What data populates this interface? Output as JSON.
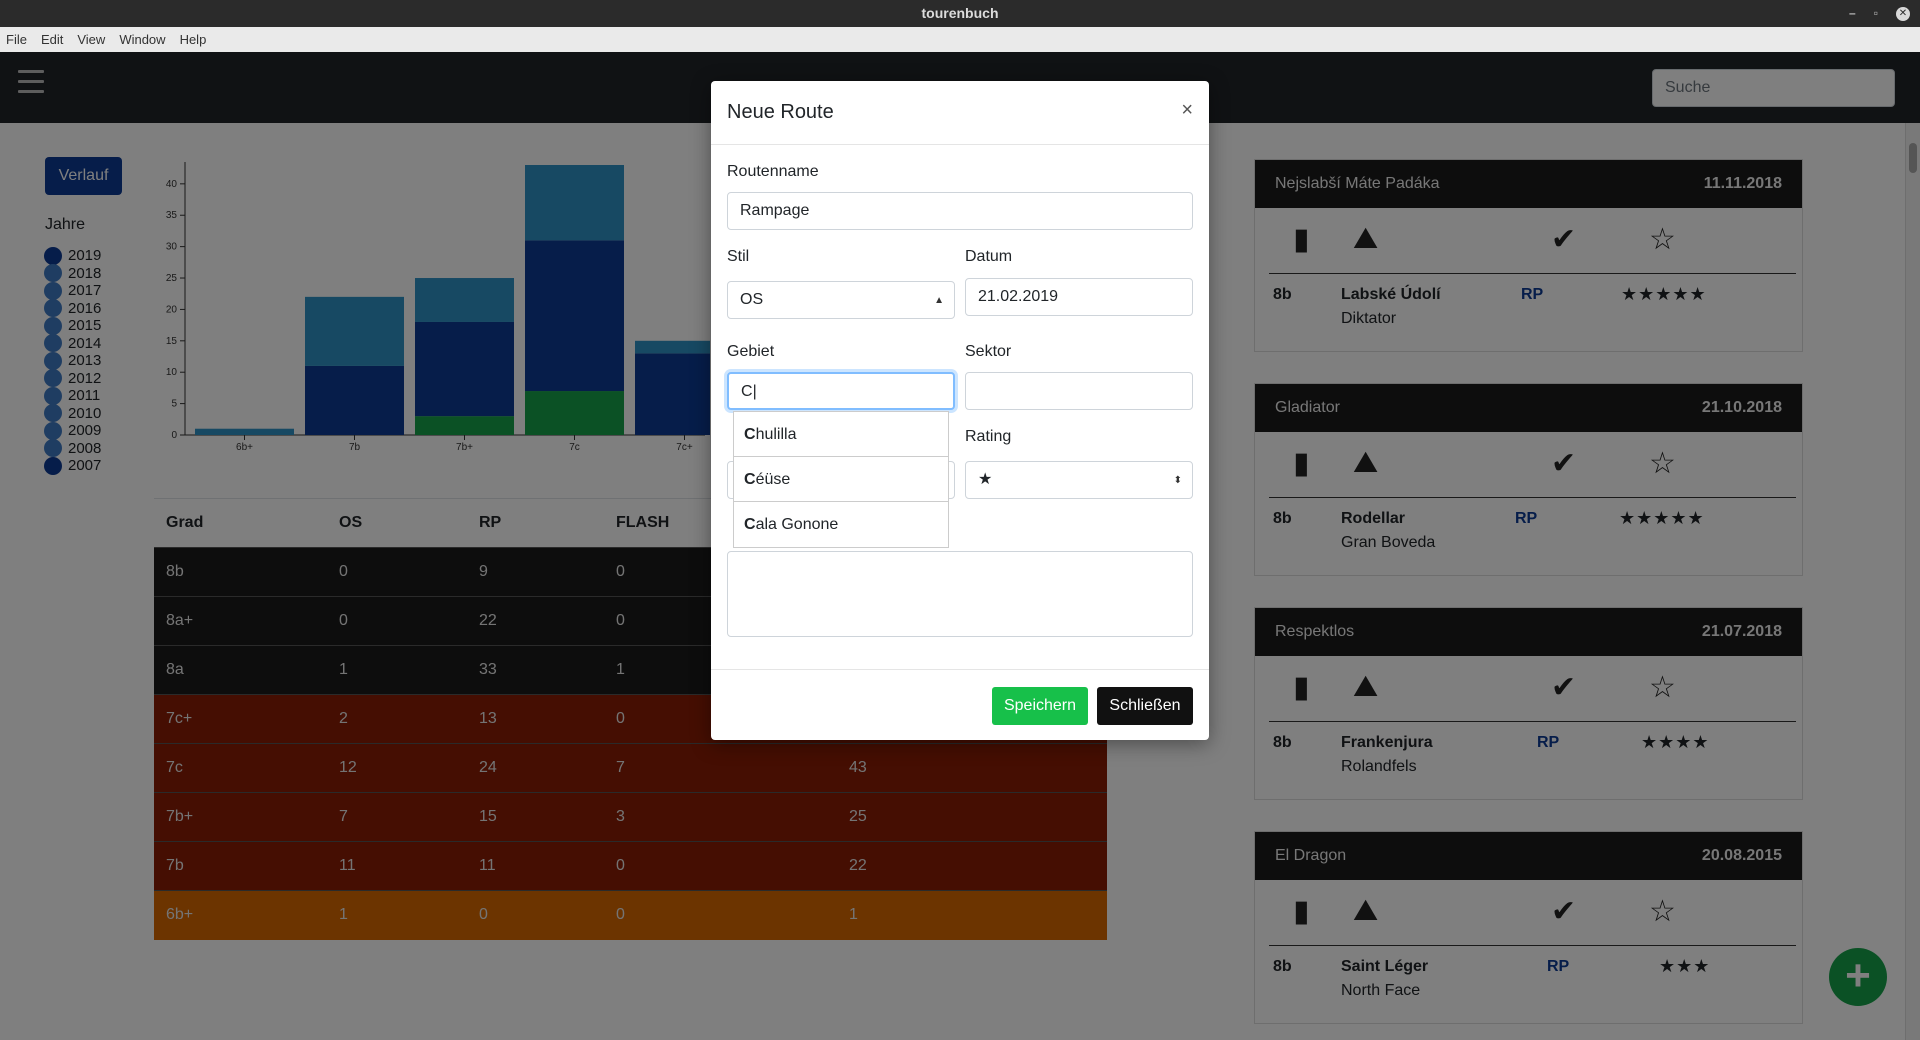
{
  "window": {
    "title": "tourenbuch",
    "controls": [
      "–",
      "▫",
      "✕"
    ]
  },
  "menu": [
    "File",
    "Edit",
    "View",
    "Window",
    "Help"
  ],
  "navbar": {
    "search_placeholder": "Suche"
  },
  "sidebar": {
    "verlauf_label": "Verlauf",
    "jahre_title": "Jahre",
    "years": [
      "2019",
      "2018",
      "2017",
      "2016",
      "2015",
      "2014",
      "2013",
      "2012",
      "2011",
      "2010",
      "2009",
      "2008",
      "2007"
    ]
  },
  "chart_data": {
    "type": "bar",
    "stacked": true,
    "categories": [
      "6b+",
      "7b",
      "7b+",
      "7c",
      "7c+"
    ],
    "series": [
      {
        "color": "#17a34a",
        "values": [
          0,
          0,
          3,
          7,
          0
        ]
      },
      {
        "color": "#0d3b94",
        "values": [
          0,
          11,
          15,
          24,
          13
        ]
      },
      {
        "color": "#2e93c6",
        "values": [
          1,
          11,
          7,
          12,
          2
        ]
      }
    ],
    "ylim": [
      0,
      43
    ],
    "yticks": [
      0,
      5,
      10,
      15,
      20,
      25,
      30,
      35,
      40
    ]
  },
  "grade_table": {
    "headers": [
      "Grad",
      "OS",
      "RP",
      "FLASH",
      ""
    ],
    "rows": [
      {
        "grad": "8b",
        "os": "0",
        "rp": "9",
        "flash": "0",
        "total": "",
        "color": "dark"
      },
      {
        "grad": "8a+",
        "os": "0",
        "rp": "22",
        "flash": "0",
        "total": "",
        "color": "dark"
      },
      {
        "grad": "8a",
        "os": "1",
        "rp": "33",
        "flash": "1",
        "total": "",
        "color": "dark"
      },
      {
        "grad": "7c+",
        "os": "2",
        "rp": "13",
        "flash": "0",
        "total": "",
        "color": "red"
      },
      {
        "grad": "7c",
        "os": "12",
        "rp": "24",
        "flash": "7",
        "total": "43",
        "color": "red"
      },
      {
        "grad": "7b+",
        "os": "7",
        "rp": "15",
        "flash": "3",
        "total": "25",
        "color": "red"
      },
      {
        "grad": "7b",
        "os": "11",
        "rp": "11",
        "flash": "0",
        "total": "22",
        "color": "red"
      },
      {
        "grad": "6b+",
        "os": "1",
        "rp": "0",
        "flash": "0",
        "total": "1",
        "color": "orange"
      }
    ]
  },
  "cards": [
    {
      "name": "Nejslabší Máte Padáka",
      "date": "11.11.2018",
      "grade": "8b",
      "area": "Labské Údolí",
      "sector": "Diktator",
      "style": "RP",
      "stars": "★★★★★"
    },
    {
      "name": "Gladiator",
      "date": "21.10.2018",
      "grade": "8b",
      "area": "Rodellar",
      "sector": "Gran Boveda",
      "style": "RP",
      "stars": "★★★★★"
    },
    {
      "name": "Respektlos",
      "date": "21.07.2018",
      "grade": "8b",
      "area": "Frankenjura",
      "sector": "Rolandfels",
      "style": "RP",
      "stars": "★★★★"
    },
    {
      "name": "El Dragon",
      "date": "20.08.2015",
      "grade": "8b",
      "area": "Saint Léger",
      "sector": "North Face",
      "style": "RP",
      "stars": "★★★"
    }
  ],
  "card_icon_glyphs": {
    "grade": "▮",
    "map": "⛰",
    "check": "✔",
    "star": "☆"
  },
  "fab_label": "+",
  "modal": {
    "title": "Neue Route",
    "close": "×",
    "routenname_label": "Routenname",
    "routenname_value": "Rampage",
    "stil_label": "Stil",
    "stil_value": "OS",
    "datum_label": "Datum",
    "datum_value": "21.02.2019",
    "gebiet_label": "Gebiet",
    "gebiet_value": "C",
    "sektor_label": "Sektor",
    "sektor_value": "",
    "rating_label": "Rating",
    "rating_value": "★",
    "suggestions": [
      {
        "match": "C",
        "rest": "hulilla"
      },
      {
        "match": "C",
        "rest": "éüse"
      },
      {
        "match": "C",
        "rest": "ala Gonone"
      }
    ],
    "save_label": "Speichern",
    "close_label": "Schließen"
  }
}
